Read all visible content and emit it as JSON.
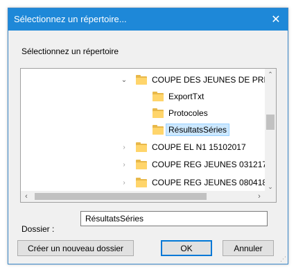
{
  "window": {
    "title": "Sélectionnez un répertoire...",
    "close_glyph": "✕"
  },
  "prompt": "Sélectionnez un répertoire",
  "tree": {
    "items": [
      {
        "label": "COUPE DES JEUNES DE PRINT",
        "expanded": true,
        "level": 0,
        "chevron": "⌄"
      },
      {
        "label": "ExportTxt",
        "level": 1
      },
      {
        "label": "Protocoles",
        "level": 1
      },
      {
        "label": "RésultatsSéries",
        "level": 1,
        "selected": true
      },
      {
        "label": "COUPE EL N1 15102017",
        "level": 0,
        "chevron": "›"
      },
      {
        "label": "COUPE REG JEUNES 031217",
        "level": 0,
        "chevron": "›"
      },
      {
        "label": "COUPE REG JEUNES 080418",
        "level": 0,
        "chevron": "›"
      }
    ],
    "vscroll": {
      "up": "⌃",
      "down": "⌄"
    },
    "hscroll": {
      "left": "‹",
      "right": "›"
    }
  },
  "folder": {
    "label": "Dossier :",
    "value": "RésultatsSéries"
  },
  "buttons": {
    "new_folder": "Créer un nouveau dossier",
    "ok": "OK",
    "cancel": "Annuler"
  },
  "colors": {
    "titlebar": "#1e88d8",
    "selection": "#cce8ff",
    "folder": "#ffd56b",
    "default_button_border": "#0078d7"
  },
  "icons": {
    "folder": "folder-icon",
    "close": "close-icon",
    "expand": "chevron-down-icon",
    "collapse": "chevron-right-icon"
  }
}
